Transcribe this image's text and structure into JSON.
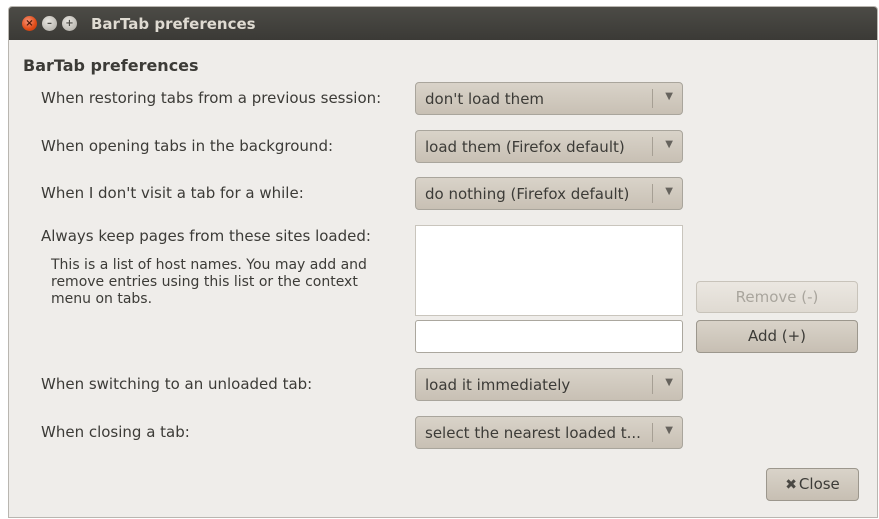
{
  "window": {
    "title": "BarTab preferences",
    "buttons": {
      "close": "×",
      "minimize": "–",
      "maximize": "+"
    }
  },
  "heading": "BarTab preferences",
  "settings": [
    {
      "label": "When restoring tabs from a previous session:",
      "value": "don't load them"
    },
    {
      "label": "When opening tabs in the background:",
      "value": "load them (Firefox default)"
    },
    {
      "label": "When I don't visit a tab for a while:",
      "value": "do nothing (Firefox default)"
    },
    {
      "label": "When switching to an unloaded tab:",
      "value": "load it immediately"
    },
    {
      "label": "When closing a tab:",
      "value": "select the nearest loaded t..."
    }
  ],
  "whitelist": {
    "label": "Always keep pages from these sites loaded:",
    "help": "This is a list of host names. You may add and remove entries using this list or the context menu on tabs.",
    "entry_value": "",
    "remove_label": "Remove (-)",
    "add_label": "Add (+)"
  },
  "footer": {
    "close_label": "Close",
    "close_icon": "✖"
  },
  "icons": {
    "dropdown_arrow": "▼"
  },
  "colors": {
    "titlebar": "#3c3b37",
    "window_bg": "#efedea",
    "close_accent": "#df4a15",
    "button_bg": "#cfc8bd"
  }
}
